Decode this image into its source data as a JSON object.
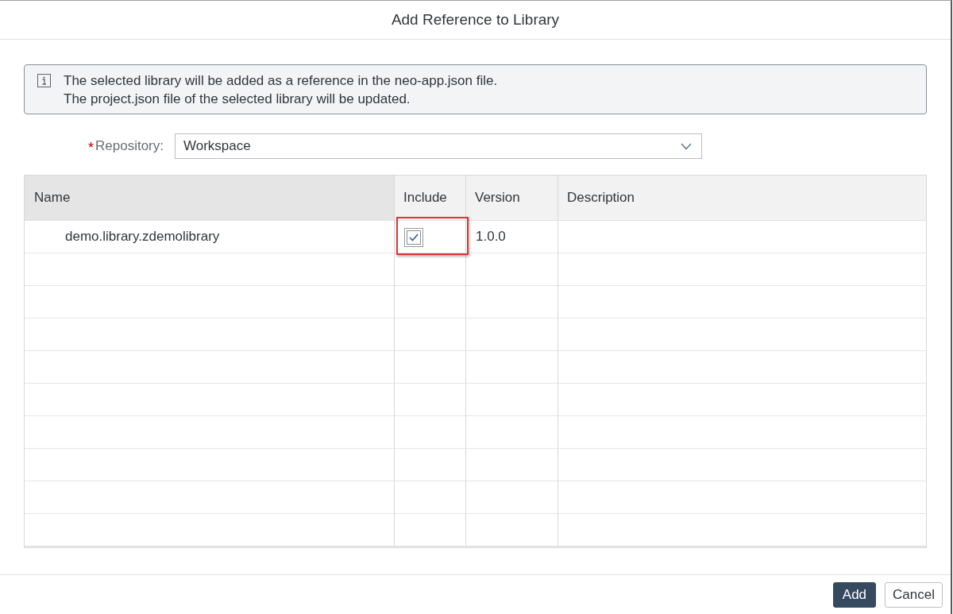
{
  "dialog": {
    "title": "Add Reference to Library"
  },
  "info_message": {
    "lines": [
      "The selected library will be added as a reference in the neo-app.json file.",
      "The project.json file of the selected library will be updated."
    ]
  },
  "repository": {
    "required_mark": "*",
    "label": "Repository:",
    "value": "Workspace"
  },
  "table": {
    "columns": [
      {
        "label": "Name",
        "highlighted": true
      },
      {
        "label": "Include",
        "highlighted": false
      },
      {
        "label": "Version",
        "highlighted": false
      },
      {
        "label": "Description",
        "highlighted": false
      }
    ],
    "rows": [
      {
        "name": "demo.library.zdemolibrary",
        "include": {
          "checked": true,
          "callout": true
        },
        "version": "1.0.0"
      }
    ]
  },
  "buttons": [
    {
      "label": "Add",
      "kind": "primary"
    },
    {
      "label": "Cancel",
      "kind": "secondary"
    }
  ]
}
